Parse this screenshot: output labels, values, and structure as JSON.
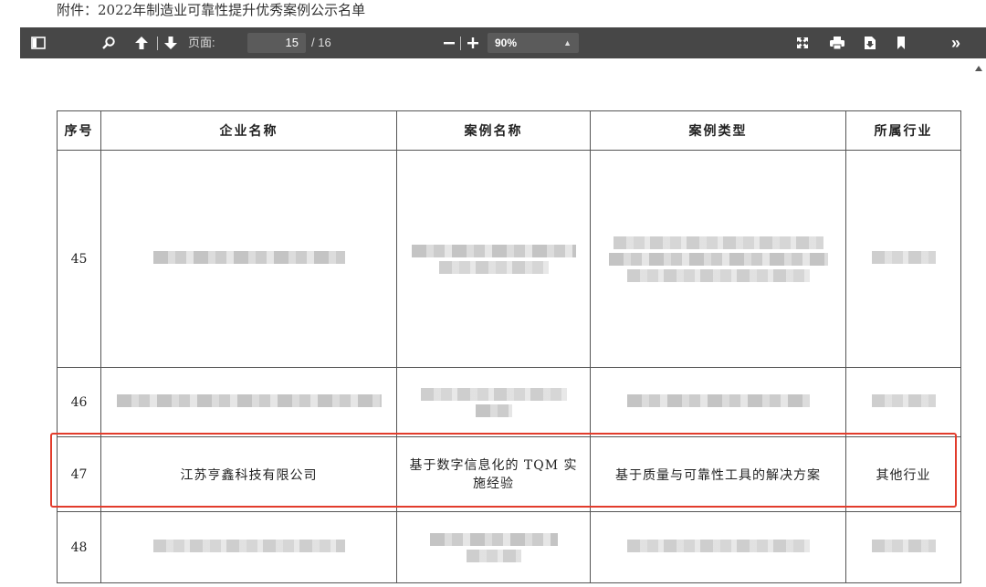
{
  "document": {
    "title": "附件：2022年制造业可靠性提升优秀案例公示名单"
  },
  "toolbar": {
    "page_label": "页面:",
    "page_current": "15",
    "page_total": "/ 16",
    "zoom_value": "90%",
    "more_label": "»"
  },
  "table": {
    "headers": [
      "序号",
      "企业名称",
      "案例名称",
      "案例类型",
      "所属行业"
    ],
    "rows": [
      {
        "index": "45",
        "company": "",
        "case_name": "",
        "case_type": "",
        "industry": ""
      },
      {
        "index": "46",
        "company": "",
        "case_name": "",
        "case_type": "",
        "industry": ""
      },
      {
        "index": "47",
        "company": "江苏亨鑫科技有限公司",
        "case_name": "基于数字信息化的 TQM 实施经验",
        "case_type": "基于质量与可靠性工具的解决方案",
        "industry": "其他行业"
      },
      {
        "index": "48",
        "company": "",
        "case_name": "",
        "case_type": "",
        "industry": ""
      }
    ]
  },
  "colors": {
    "toolbar_bg": "#474747",
    "highlight": "#e23c2c"
  }
}
